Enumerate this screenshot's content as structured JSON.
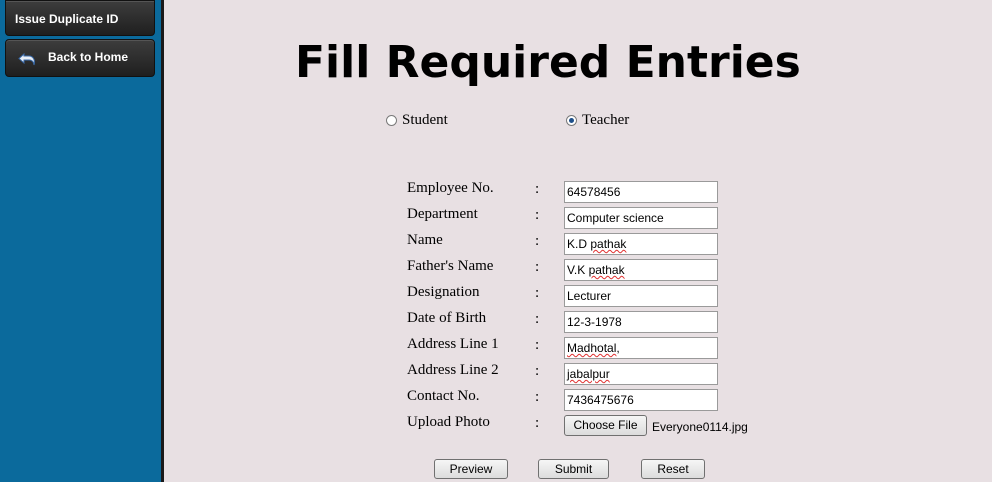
{
  "sidebar": {
    "items": [
      {
        "label": "Issue Duplicate ID"
      },
      {
        "label": "Back to Home",
        "icon": "back-arrow-icon"
      }
    ]
  },
  "page": {
    "title": "Fill Required Entries"
  },
  "role": {
    "options": [
      {
        "label": "Student",
        "checked": false
      },
      {
        "label": "Teacher",
        "checked": true
      }
    ]
  },
  "form": {
    "colon": ":",
    "fields": [
      {
        "label": "Employee No.",
        "value": "64578456"
      },
      {
        "label": "Department",
        "value": "Computer science"
      },
      {
        "label": "Name",
        "value_a": "K.D ",
        "value_b": "pathak"
      },
      {
        "label": "Father's Name",
        "value_a": "V.K ",
        "value_b": "pathak"
      },
      {
        "label": "Designation",
        "value": "Lecturer"
      },
      {
        "label": "Date of Birth",
        "value": "12-3-1978"
      },
      {
        "label": "Address Line 1",
        "value_a": "Madhotal",
        "value_b": ","
      },
      {
        "label": "Address Line 2",
        "value": "jabalpur"
      },
      {
        "label": "Contact No.",
        "value": "7436475676"
      }
    ],
    "upload": {
      "label": "Upload Photo",
      "button_label": "Choose File",
      "filename": "Everyone0114.jpg"
    }
  },
  "actions": {
    "preview_label": "Preview",
    "submit_label": "Submit",
    "reset_label": "Reset"
  }
}
